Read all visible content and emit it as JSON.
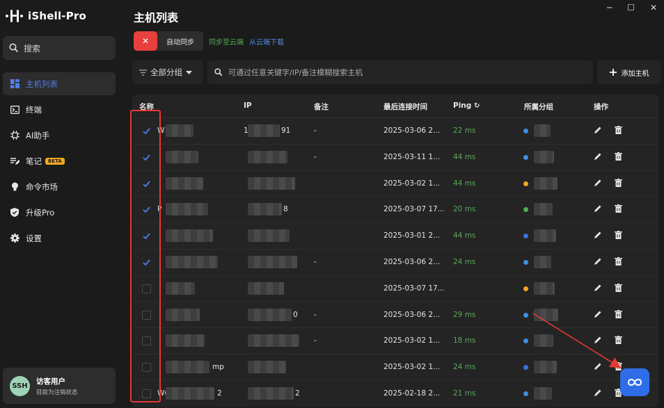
{
  "app": {
    "name": "iShell-Pro"
  },
  "sidebar": {
    "search_label": "搜索",
    "items": [
      {
        "label": "主机列表",
        "icon": "grid-icon",
        "active": true
      },
      {
        "label": "终端",
        "icon": "terminal-icon"
      },
      {
        "label": "AI助手",
        "icon": "chip-icon"
      },
      {
        "label": "笔记",
        "icon": "note-icon",
        "badge": "BETA"
      },
      {
        "label": "命令市场",
        "icon": "bulb-icon"
      },
      {
        "label": "升级Pro",
        "icon": "shield-icon"
      },
      {
        "label": "设置",
        "icon": "gear-icon"
      }
    ],
    "user": {
      "avatar": "SSH",
      "name": "访客用户",
      "status": "目前为注销状态"
    }
  },
  "header": {
    "title": "主机列表"
  },
  "sync": {
    "toggle_off": "✕",
    "auto_sync": "自动同步",
    "to_cloud": "同步至云端",
    "from_cloud": "从云端下载"
  },
  "filter": {
    "group": "全部分组",
    "search_placeholder": "可通过任意关键字/IP/备注模糊搜索主机",
    "add_host": "添加主机"
  },
  "table": {
    "columns": [
      "名称",
      "IP",
      "备注",
      "最后连接时间",
      "Ping",
      "所属分组",
      "操作"
    ],
    "rows": [
      {
        "checked": true,
        "name_prefix": "W1",
        "name_suffix": "",
        "ip_prefix": "1",
        "ip_suffix": "91",
        "remark": "-",
        "time": "2025-03-06 2...",
        "ping": "22 ms",
        "group_color": "#3d8fe0"
      },
      {
        "checked": true,
        "name_prefix": "",
        "name_suffix": "",
        "ip_prefix": "",
        "ip_suffix": "",
        "remark": "-",
        "time": "2025-03-11 1...",
        "ping": "44 ms",
        "group_color": "#3d8fe0"
      },
      {
        "checked": true,
        "name_prefix": "",
        "name_suffix": "",
        "ip_prefix": "",
        "ip_suffix": "",
        "remark": "",
        "time": "2025-03-02 1...",
        "ping": "44 ms",
        "group_color": "#f5a623"
      },
      {
        "checked": true,
        "name_prefix": "P",
        "name_suffix": "",
        "ip_prefix": "",
        "ip_suffix": "8",
        "remark": "",
        "time": "2025-03-07 17...",
        "ping": "20 ms",
        "group_color": "#4caf50"
      },
      {
        "checked": true,
        "name_prefix": "",
        "name_suffix": "",
        "ip_prefix": "",
        "ip_suffix": "",
        "remark": "",
        "time": "2025-03-01 2...",
        "ping": "44 ms",
        "group_color": "#3d6fe0"
      },
      {
        "checked": true,
        "name_prefix": "",
        "name_suffix": "",
        "ip_prefix": "",
        "ip_suffix": "",
        "remark": "-",
        "time": "2025-03-06 2...",
        "ping": "24 ms",
        "group_color": "#3d8fe0"
      },
      {
        "checked": false,
        "name_prefix": "",
        "name_suffix": "",
        "ip_prefix": "",
        "ip_suffix": "",
        "remark": "",
        "time": "2025-03-07 17...",
        "ping": "",
        "group_color": "#f5a623"
      },
      {
        "checked": false,
        "name_prefix": "",
        "name_suffix": "",
        "ip_prefix": "",
        "ip_suffix": "0",
        "remark": "-",
        "time": "2025-03-06 2...",
        "ping": "29 ms",
        "group_color": "#3d8fe0"
      },
      {
        "checked": false,
        "name_prefix": "",
        "name_suffix": "",
        "ip_prefix": "",
        "ip_suffix": "",
        "remark": "-",
        "time": "2025-03-02 1...",
        "ping": "18 ms",
        "group_color": "#3d8fe0"
      },
      {
        "checked": false,
        "name_prefix": "",
        "name_suffix": "mp",
        "ip_prefix": "",
        "ip_suffix": "",
        "remark": "",
        "time": "2025-03-02 1...",
        "ping": "24 ms",
        "group_color": "#3d6fe0"
      },
      {
        "checked": false,
        "name_prefix": "W6",
        "name_suffix": "2",
        "ip_prefix": "",
        "ip_suffix": "2",
        "remark": "",
        "time": "2025-02-18 2...",
        "ping": "21 ms",
        "group_color": "#3d8fe0"
      }
    ]
  },
  "colors": {
    "accent": "#4f7fe8",
    "danger": "#e8403c",
    "annotation": "#e53935"
  }
}
